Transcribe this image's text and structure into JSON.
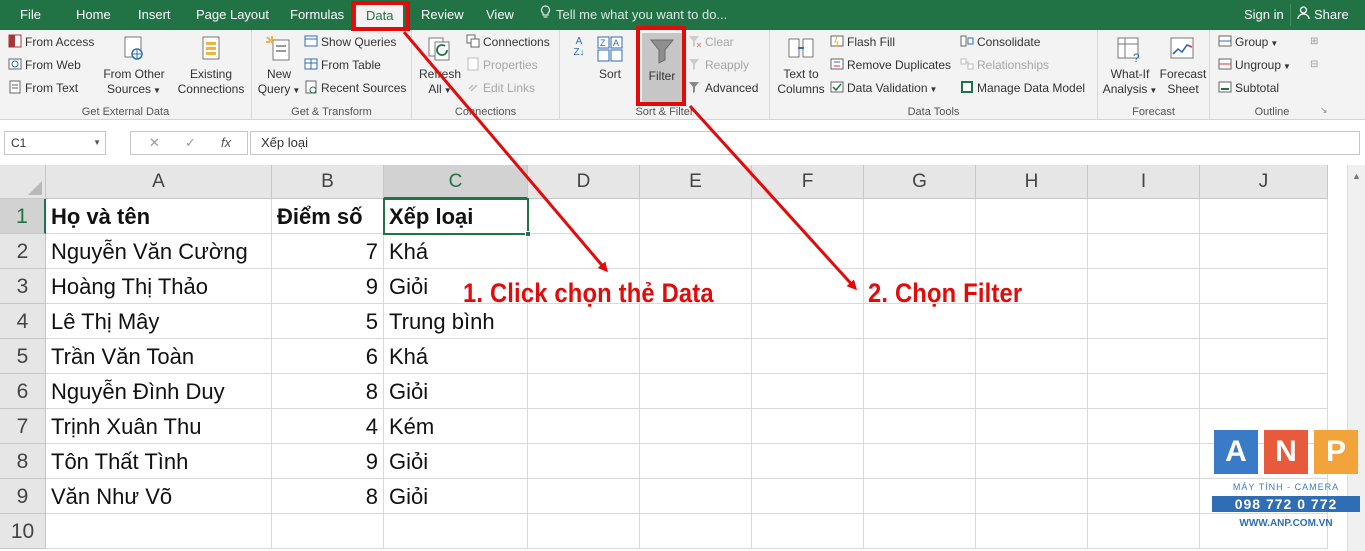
{
  "tabs": [
    {
      "label": "File"
    },
    {
      "label": "Home"
    },
    {
      "label": "Insert"
    },
    {
      "label": "Page Layout"
    },
    {
      "label": "Formulas"
    },
    {
      "label": "Data",
      "active": true
    },
    {
      "label": "Review"
    },
    {
      "label": "View"
    }
  ],
  "tell_me": "Tell me what you want to do...",
  "account": {
    "signin": "Sign in",
    "share": "Share"
  },
  "ribbon": {
    "get_external": {
      "label": "Get External Data",
      "from_access": "From Access",
      "from_web": "From Web",
      "from_text": "From Text",
      "from_other_1": "From Other",
      "from_other_2": "Sources",
      "existing_1": "Existing",
      "existing_2": "Connections"
    },
    "get_transform": {
      "label": "Get & Transform",
      "new_query_1": "New",
      "new_query_2": "Query",
      "show_queries": "Show Queries",
      "from_table": "From Table",
      "recent_sources": "Recent Sources"
    },
    "connections": {
      "label": "Connections",
      "refresh_1": "Refresh",
      "refresh_2": "All",
      "connections": "Connections",
      "properties": "Properties",
      "edit_links": "Edit Links"
    },
    "sort_filter": {
      "label": "Sort & Filter",
      "sort": "Sort",
      "filter": "Filter",
      "clear": "Clear",
      "reapply": "Reapply",
      "advanced": "Advanced"
    },
    "data_tools": {
      "label": "Data Tools",
      "text_to_columns_1": "Text to",
      "text_to_columns_2": "Columns",
      "flash_fill": "Flash Fill",
      "remove_duplicates": "Remove Duplicates",
      "data_validation": "Data Validation",
      "consolidate": "Consolidate",
      "relationships": "Relationships",
      "manage_data_model": "Manage Data Model"
    },
    "forecast": {
      "label": "Forecast",
      "what_if_1": "What-If",
      "what_if_2": "Analysis",
      "forecast_sheet_1": "Forecast",
      "forecast_sheet_2": "Sheet"
    },
    "outline": {
      "label": "Outline",
      "group": "Group",
      "ungroup": "Ungroup",
      "subtotal": "Subtotal"
    }
  },
  "formula_bar": {
    "name_box": "C1",
    "cancel": "✕",
    "enter": "✓",
    "fx": "fx",
    "content": "Xếp loại"
  },
  "columns": [
    "A",
    "B",
    "C",
    "D",
    "E",
    "F",
    "G",
    "H",
    "I",
    "J"
  ],
  "selected_column": "C",
  "selected_row": 1,
  "rows": [
    {
      "num": "1",
      "a": "Họ và tên",
      "b": "Điểm số",
      "c": "Xếp loại"
    },
    {
      "num": "2",
      "a": "Nguyễn Văn Cường",
      "b": "7",
      "c": "Khá"
    },
    {
      "num": "3",
      "a": "Hoàng Thị Thảo",
      "b": "9",
      "c": "Giỏi"
    },
    {
      "num": "4",
      "a": "Lê Thị Mây",
      "b": "5",
      "c": "Trung bình"
    },
    {
      "num": "5",
      "a": "Trần Văn Toàn",
      "b": "6",
      "c": "Khá"
    },
    {
      "num": "6",
      "a": "Nguyễn Đình Duy",
      "b": "8",
      "c": "Giỏi"
    },
    {
      "num": "7",
      "a": "Trịnh Xuân Thu",
      "b": "4",
      "c": "Kém"
    },
    {
      "num": "8",
      "a": "Tôn Thất Tình",
      "b": "9",
      "c": "Giỏi"
    },
    {
      "num": "9",
      "a": "Văn Như Võ",
      "b": "8",
      "c": "Giỏi"
    },
    {
      "num": "10",
      "a": "",
      "b": "",
      "c": ""
    }
  ],
  "annotations": {
    "step1": "1. Click chọn thẻ Data",
    "step2": "2. Chọn Filter",
    "color": "#e30a0a"
  },
  "watermark": {
    "letters": [
      "A",
      "N",
      "P"
    ],
    "subtitle": "MÁY TÍNH - CAMERA",
    "phone": "098 772 0 772",
    "website": "WWW.ANP.COM.VN"
  },
  "colors": {
    "excel_green": "#217346",
    "ribbon_bg": "#f3f3f3"
  }
}
